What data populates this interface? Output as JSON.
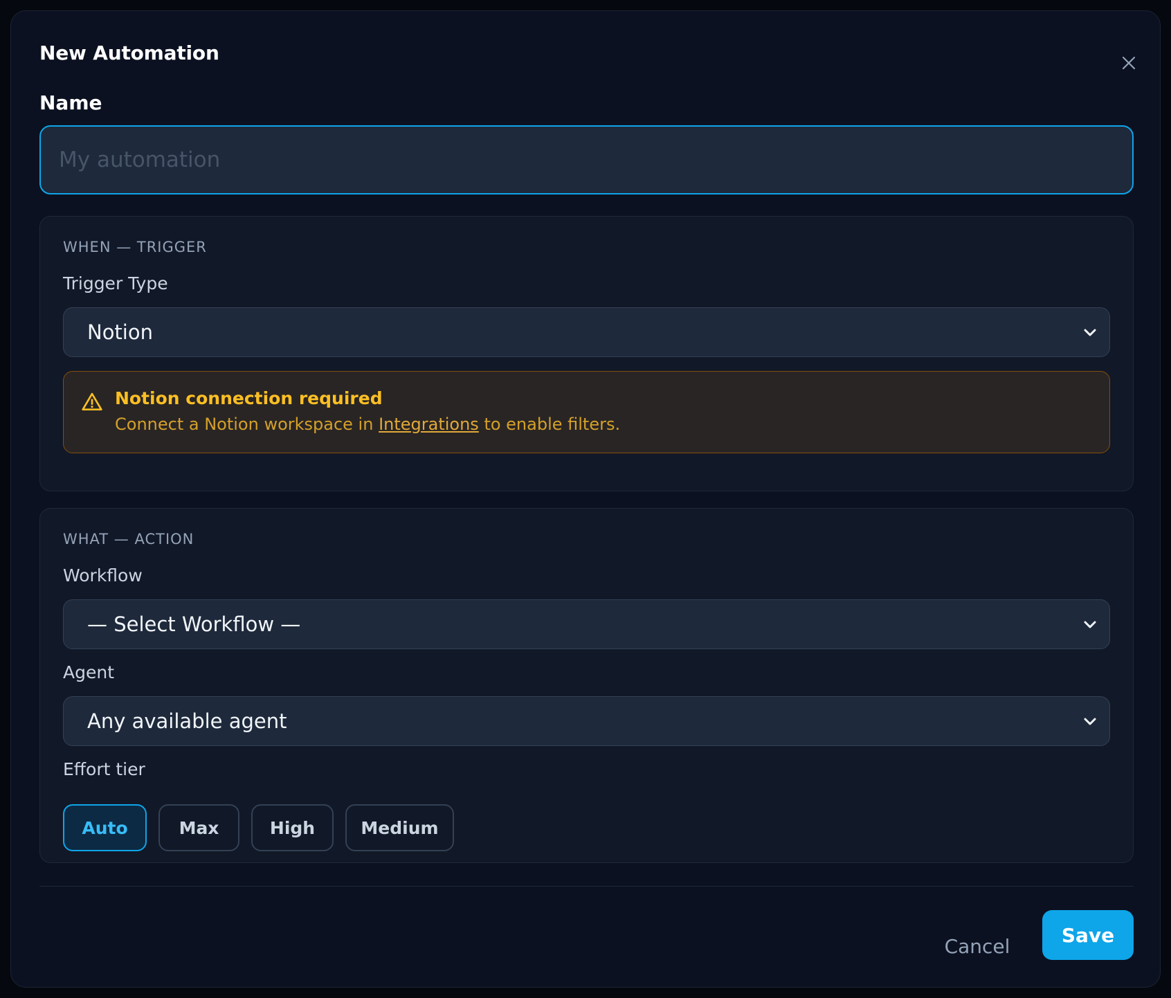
{
  "dialog": {
    "title": "New Automation",
    "close_icon": "close-icon"
  },
  "name_field": {
    "label": "Name",
    "placeholder": "My automation",
    "value": ""
  },
  "trigger_section": {
    "heading": "WHEN — TRIGGER",
    "trigger_type": {
      "label": "Trigger Type",
      "selected": "Notion"
    },
    "warning": {
      "icon": "warning-triangle-icon",
      "title": "Notion connection required",
      "text_before": "Connect a Notion workspace in ",
      "link": "Integrations",
      "text_after": " to enable filters."
    }
  },
  "action_section": {
    "heading": "WHAT — ACTION",
    "workflow": {
      "label": "Workflow",
      "selected": "— Select Workflow —"
    },
    "agent": {
      "label": "Agent",
      "selected": "Any available agent"
    },
    "effort_tier": {
      "label": "Effort tier",
      "options": [
        "Auto",
        "Max",
        "High",
        "Medium"
      ],
      "selected": "Auto"
    }
  },
  "footer": {
    "cancel_label": "Cancel",
    "save_label": "Save"
  },
  "colors": {
    "accent": "#0ea5e9",
    "warning": "#fbbf24",
    "background": "#0b1120",
    "section": "#111827"
  }
}
